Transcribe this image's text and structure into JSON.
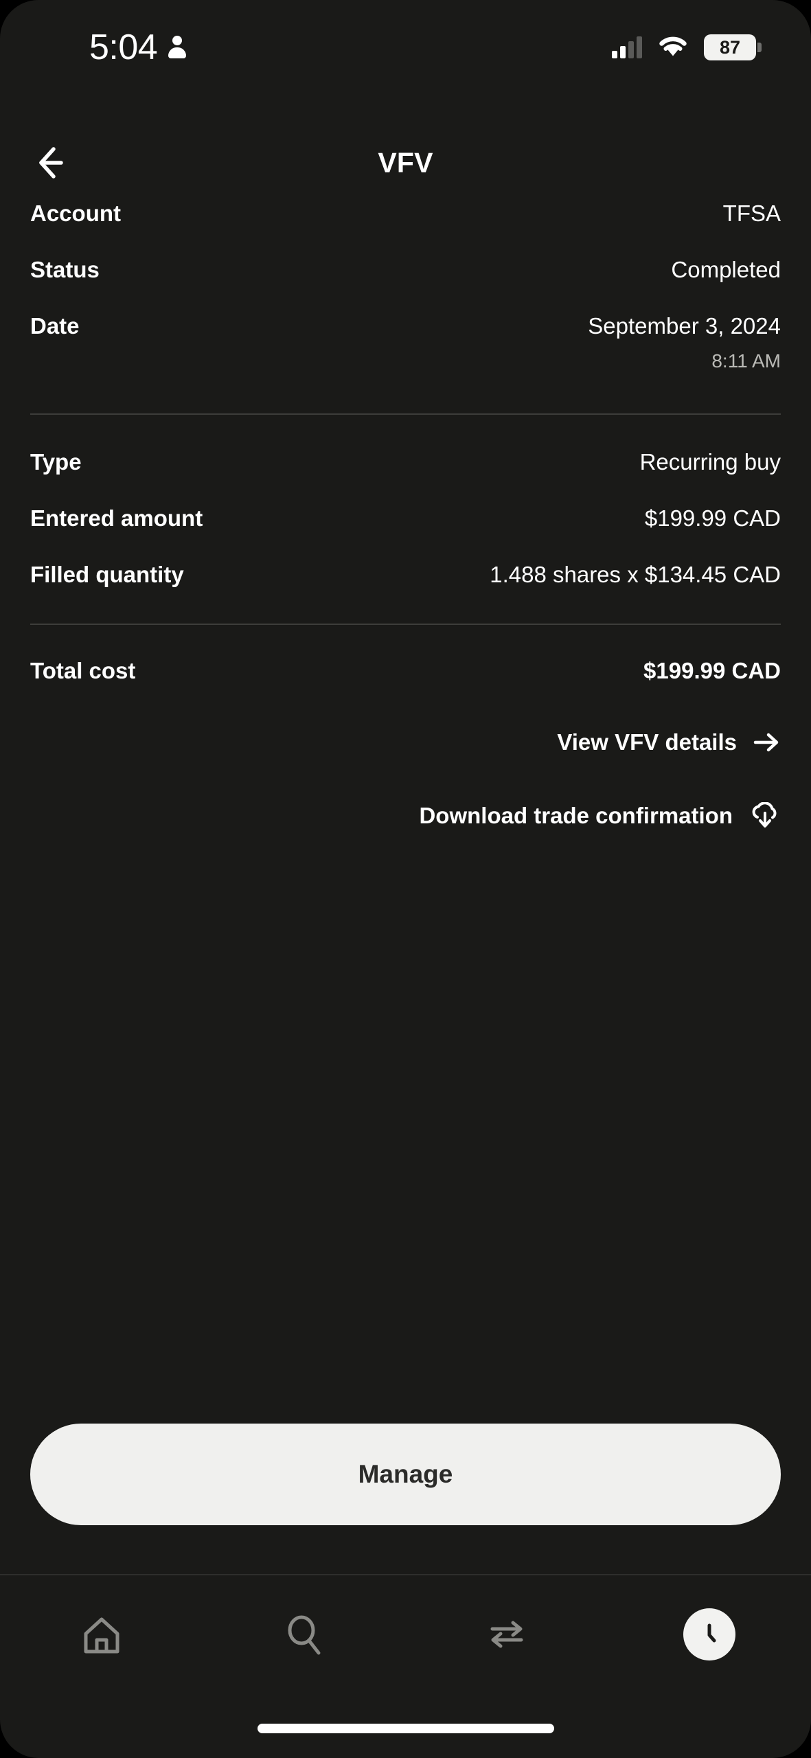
{
  "status_bar": {
    "time": "5:04",
    "person_icon": "person-icon",
    "signal_icon": "signal-bars-icon",
    "wifi_icon": "wifi-icon",
    "battery_level": "87",
    "battery_icon": "battery-icon"
  },
  "header": {
    "back_icon": "arrow-left-icon",
    "title": "VFV"
  },
  "details": {
    "section_one": [
      {
        "label": "Account",
        "value": "TFSA"
      },
      {
        "label": "Status",
        "value": "Completed"
      },
      {
        "label": "Date",
        "value": "September 3, 2024",
        "subvalue": "8:11 AM"
      }
    ],
    "section_two": [
      {
        "label": "Type",
        "value": "Recurring buy"
      },
      {
        "label": "Entered amount",
        "value": "$199.99 CAD"
      },
      {
        "label": "Filled quantity",
        "value": "1.488 shares x $134.45 CAD"
      }
    ],
    "section_three": [
      {
        "label": "Total cost",
        "value": "$199.99 CAD"
      }
    ]
  },
  "links": {
    "view_details": {
      "label": "View VFV details",
      "icon": "arrow-right-icon"
    },
    "download": {
      "label": "Download trade confirmation",
      "icon": "cloud-download-icon"
    }
  },
  "primary_button": {
    "label": "Manage"
  },
  "bottom_nav": {
    "items": [
      {
        "name": "home",
        "icon": "home-icon",
        "active": false
      },
      {
        "name": "search",
        "icon": "search-icon",
        "active": false
      },
      {
        "name": "transfer",
        "icon": "transfer-arrows-icon",
        "active": false
      },
      {
        "name": "activity",
        "icon": "clock-icon",
        "active": true
      }
    ]
  },
  "colors": {
    "background": "#1a1a18",
    "text_primary": "#ffffff",
    "text_muted": "#b9b9b5",
    "divider": "#3d3d3a",
    "button_bg": "#f0f0ee",
    "button_text": "#2b2b29",
    "nav_inactive": "#8a8a86"
  }
}
